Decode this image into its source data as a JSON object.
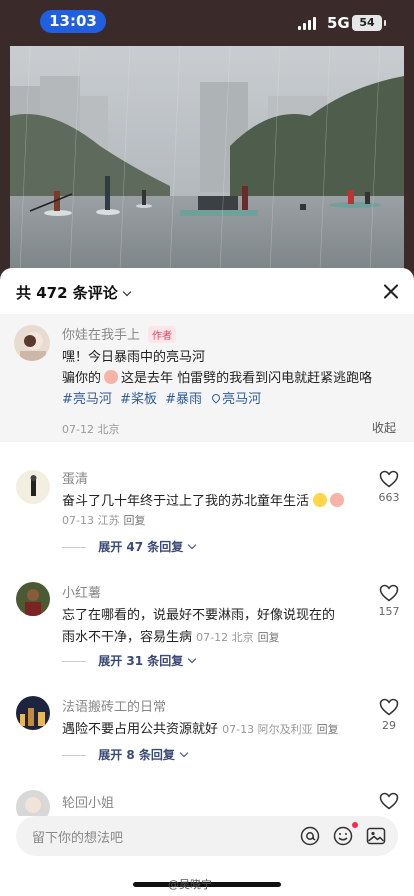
{
  "status": {
    "time": "13:03",
    "network": "5G",
    "battery": "54"
  },
  "sheet": {
    "count_title": "共 472 条评论"
  },
  "author_post": {
    "name": "你娃在我手上",
    "tag": "作者",
    "line1": "嘿！今日暴雨中的亮马河",
    "line2_prefix": "骗你的",
    "line2_suffix": "这是去年 怕雷劈的我看到闪电就赶紧逃跑咯",
    "hashtags": [
      "#亮马河",
      "#桨板",
      "#暴雨"
    ],
    "location_tag": "亮马河",
    "date_loc": "07-12 北京",
    "collapse_label": "收起"
  },
  "comments": [
    {
      "name": "蛋清",
      "text": "奋斗了几十年终于过上了我的苏北童年生活",
      "meta": "07-13 江苏",
      "reply": "回复",
      "likes": "663",
      "expand": "展开 47 条回复"
    },
    {
      "name": "小红薯",
      "text_line1": "忘了在哪看的，说最好不要淋雨，好像说现在的",
      "text_line2": "雨水不干净，容易生病",
      "meta": "07-12 北京",
      "reply": "回复",
      "likes": "157",
      "expand": "展开 31 条回复"
    },
    {
      "name": "法语搬砖工的日常",
      "text": "遇险不要占用公共资源就好",
      "meta": "07-13 阿尔及利亚",
      "reply": "回复",
      "likes": "29",
      "expand": "展开 8 条回复"
    },
    {
      "name": "轮回小姐"
    }
  ],
  "input": {
    "placeholder": "留下你的想法吧"
  },
  "watermark": "@吴晓宁",
  "icons": {
    "close": "close-icon",
    "chevron": "chevron-down-icon",
    "heart": "heart-icon",
    "at": "at-icon",
    "emoji": "emoji-icon",
    "image": "image-icon",
    "location": "location-pin-icon"
  },
  "colors": {
    "time_pill": "#1f5fe0",
    "hashtag": "#2f5d9b",
    "author_tag": "#e2465c",
    "expand": "#3a4a78"
  }
}
